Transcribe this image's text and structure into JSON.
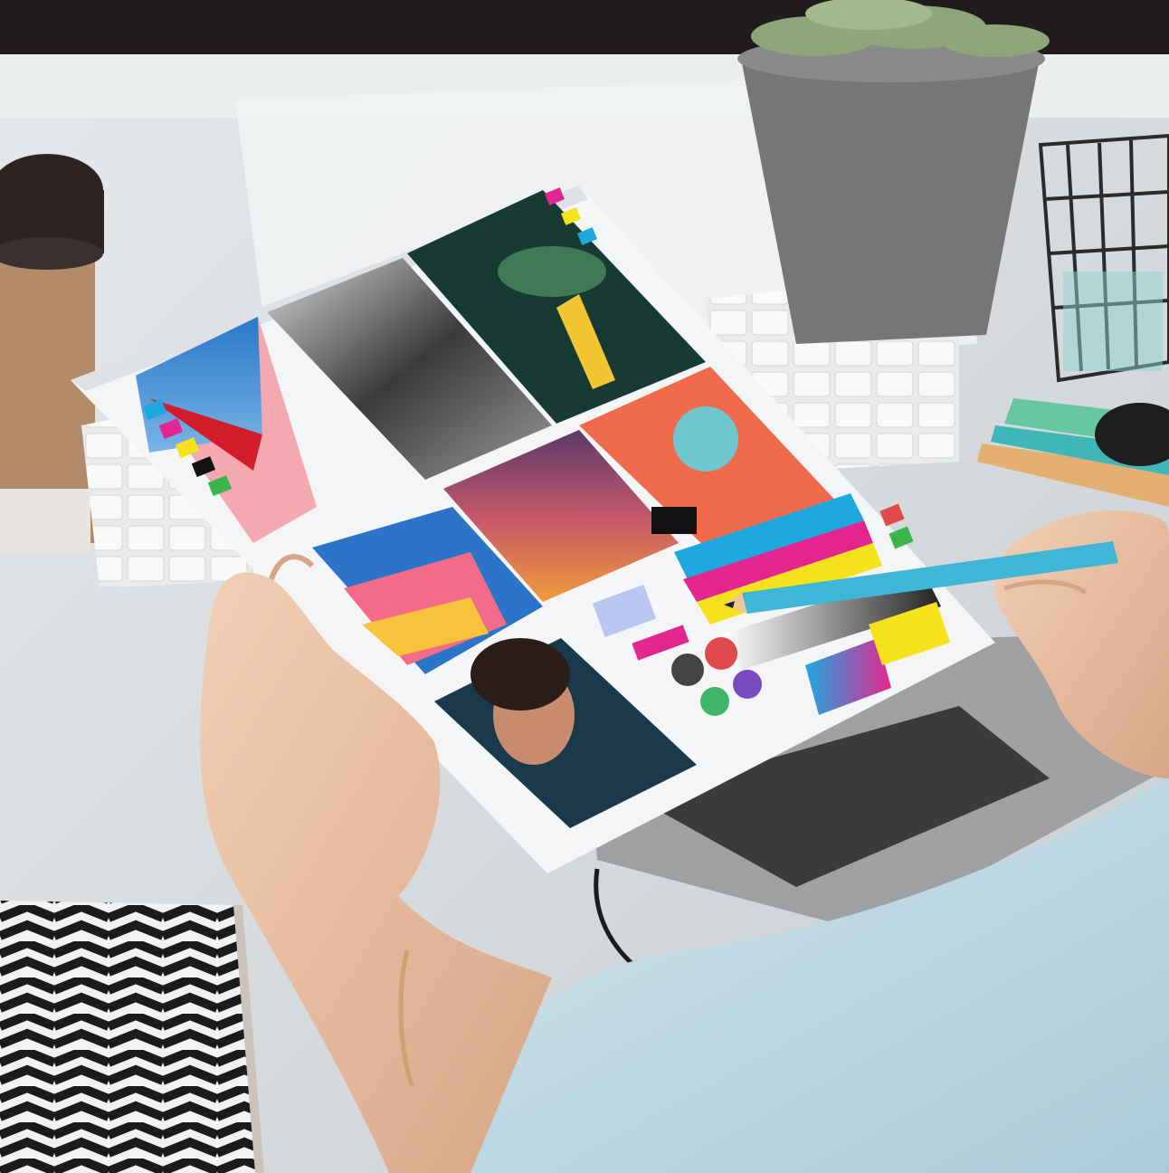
{
  "scene": {
    "subject": "print-proof-sheet-review",
    "palette": {
      "desk": "#d9dde0",
      "desk_shadow": "#b9bfc3",
      "monitor_frame": "#2a2627",
      "monitor_screen": "#eef0f1",
      "paper": "#f4f5f6",
      "skin": "#e9c1a4",
      "skin_shade": "#d7a486",
      "sweater": "#b9d7e2",
      "pencil": "#3fb6d6",
      "cup_sleeve": "#b58d6a",
      "cup_lid": "#2d2222",
      "pot": "#7a7778",
      "succulent": "#8fa57a",
      "tablet": "#9d9fa1",
      "zigzag_dark": "#1b1b1b",
      "cyan": "#1ea8e0",
      "magenta": "#e3268f",
      "yellow": "#f6e21a",
      "black": "#111111"
    },
    "objects": [
      "monitor",
      "coffee-cup",
      "keyboard",
      "succulent-pot",
      "wire-basket",
      "sticky-notes",
      "graphics-tablet",
      "zigzag-notebook",
      "proof-sheet",
      "left-hand",
      "right-hand",
      "pencil",
      "bracelet"
    ]
  }
}
